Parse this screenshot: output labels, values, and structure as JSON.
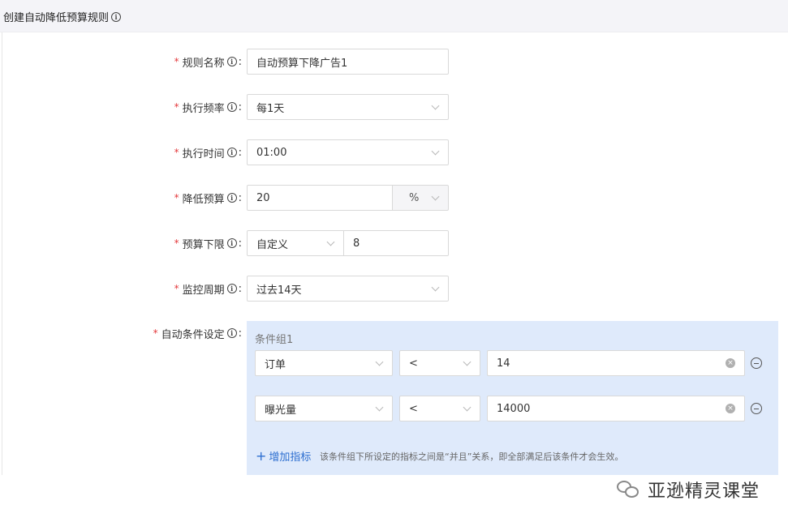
{
  "header": {
    "title": "创建自动降低预算规则"
  },
  "form": {
    "rule_name": {
      "label": "规则名称",
      "value": "自动预算下降广告1"
    },
    "frequency": {
      "label": "执行频率",
      "value": "每1天"
    },
    "exec_time": {
      "label": "执行时间",
      "value": "01:00"
    },
    "reduce_budget": {
      "label": "降低预算",
      "value": "20",
      "unit": "%"
    },
    "budget_floor": {
      "label": "预算下限",
      "mode": "自定义",
      "value": "8"
    },
    "monitor_period": {
      "label": "监控周期",
      "value": "过去14天"
    },
    "auto_condition": {
      "label": "自动条件设定"
    }
  },
  "conditions": {
    "group_label": "条件组1",
    "rows": [
      {
        "metric": "订单",
        "operator": "<",
        "value": "14"
      },
      {
        "metric": "曝光量",
        "operator": "<",
        "value": "14000"
      }
    ],
    "add_label": "增加指标",
    "hint": "该条件组下所设定的指标之间是“并且”关系，即全部满足后该条件才会生效。"
  },
  "watermark": {
    "text": "亚逊精灵课堂"
  }
}
